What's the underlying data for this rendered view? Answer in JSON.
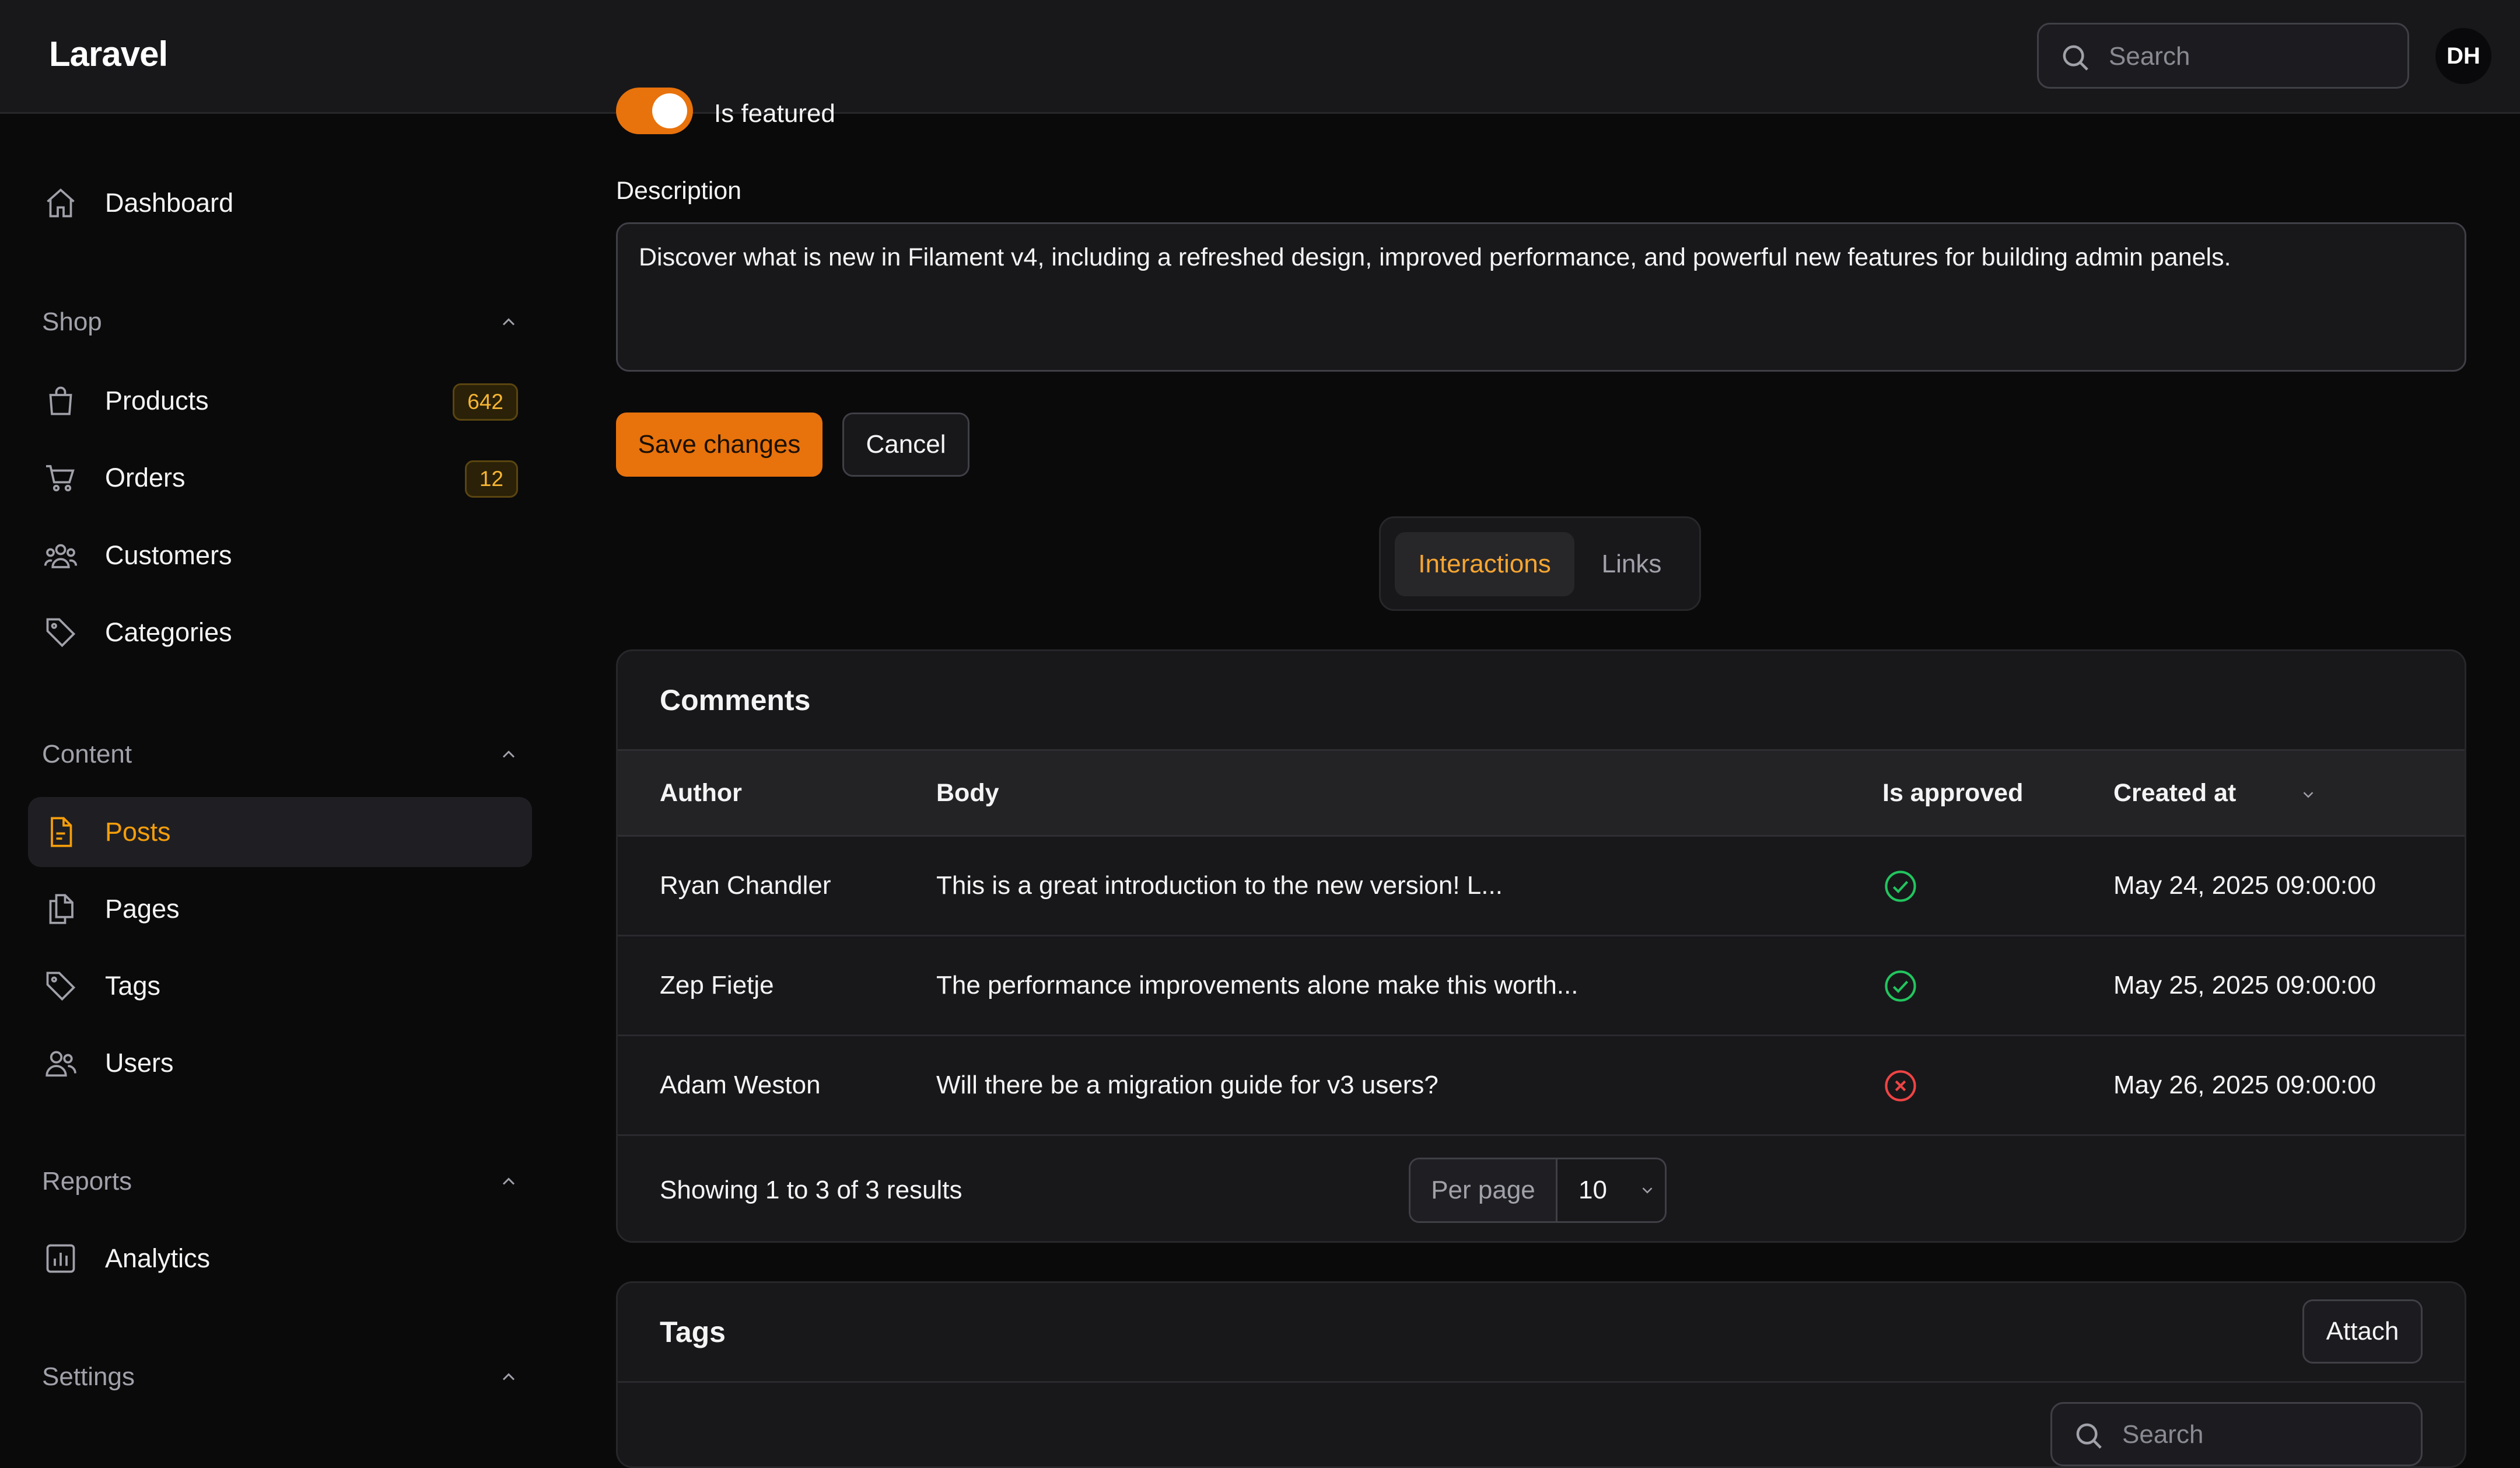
{
  "app": {
    "brand": "Laravel",
    "avatar_initials": "DH"
  },
  "search": {
    "placeholder": "Search"
  },
  "sidebar": {
    "dashboard": "Dashboard",
    "groups": {
      "shop": "Shop",
      "content": "Content",
      "reports": "Reports",
      "settings": "Settings"
    },
    "items": {
      "products": {
        "label": "Products",
        "badge": "642"
      },
      "orders": {
        "label": "Orders",
        "badge": "12"
      },
      "customers": {
        "label": "Customers"
      },
      "categories": {
        "label": "Categories"
      },
      "posts": {
        "label": "Posts"
      },
      "pages": {
        "label": "Pages"
      },
      "tags": {
        "label": "Tags"
      },
      "users": {
        "label": "Users"
      },
      "analytics": {
        "label": "Analytics"
      }
    }
  },
  "form": {
    "featured_label": "Is featured",
    "featured_on": true,
    "description_label": "Description",
    "description_value": "Discover what is new in Filament v4, including a refreshed design, improved performance, and powerful new features for building admin panels.",
    "save_label": "Save changes",
    "cancel_label": "Cancel"
  },
  "tabs": {
    "interactions": "Interactions",
    "links": "Links"
  },
  "comments": {
    "title": "Comments",
    "columns": {
      "author": "Author",
      "body": "Body",
      "approved": "Is approved",
      "created": "Created at"
    },
    "rows": [
      {
        "author": "Ryan Chandler",
        "body": "This is a great introduction to the new version! L...",
        "approved": true,
        "created": "May 24, 2025 09:00:00"
      },
      {
        "author": "Zep Fietje",
        "body": "The performance improvements alone make this worth...",
        "approved": true,
        "created": "May 25, 2025 09:00:00"
      },
      {
        "author": "Adam Weston",
        "body": "Will there be a migration guide for v3 users?",
        "approved": false,
        "created": "May 26, 2025 09:00:00"
      }
    ],
    "summary": "Showing 1 to 3 of 3 results",
    "per_page_label": "Per page",
    "per_page_value": "10"
  },
  "tags_card": {
    "title": "Tags",
    "attach_label": "Attach",
    "search_placeholder": "Search"
  },
  "colors": {
    "accent": "#f59e0b",
    "primary_button": "#e8720c",
    "approved": "#22c55e",
    "rejected": "#ef4444"
  }
}
